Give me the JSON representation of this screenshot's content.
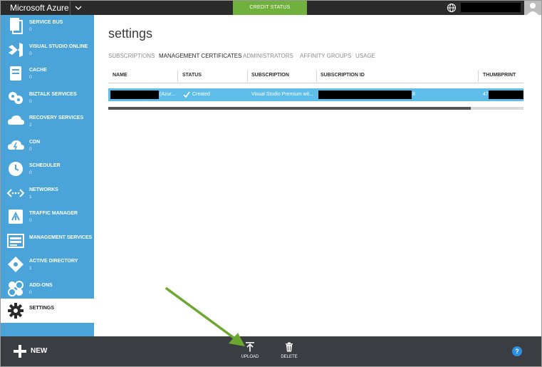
{
  "topbar": {
    "brand": "Microsoft Azure",
    "credit_status": "CREDIT STATUS"
  },
  "sidebar": {
    "items": [
      {
        "label": "SERVICE BUS",
        "count": "0",
        "icon": "service-bus-icon"
      },
      {
        "label": "VISUAL STUDIO ONLINE",
        "count": "0",
        "icon": "visual-studio-icon"
      },
      {
        "label": "CACHE",
        "count": "0",
        "icon": "cache-icon"
      },
      {
        "label": "BIZTALK SERVICES",
        "count": "0",
        "icon": "biztalk-icon"
      },
      {
        "label": "RECOVERY SERVICES",
        "count": "2",
        "icon": "recovery-icon"
      },
      {
        "label": "CDN",
        "count": "0",
        "icon": "cdn-icon"
      },
      {
        "label": "SCHEDULER",
        "count": "0",
        "icon": "scheduler-icon"
      },
      {
        "label": "NETWORKS",
        "count": "1",
        "icon": "networks-icon"
      },
      {
        "label": "TRAFFIC MANAGER",
        "count": "0",
        "icon": "traffic-manager-icon"
      },
      {
        "label": "MANAGEMENT SERVICES",
        "count": "",
        "icon": "management-services-icon"
      },
      {
        "label": "ACTIVE DIRECTORY",
        "count": "1",
        "icon": "active-directory-icon"
      },
      {
        "label": "ADD-ONS",
        "count": "0",
        "icon": "add-ons-icon"
      },
      {
        "label": "SETTINGS",
        "count": "",
        "icon": "gear-icon",
        "active": true
      }
    ]
  },
  "main": {
    "title": "settings",
    "tabs": [
      {
        "label": "SUBSCRIPTIONS",
        "active": false
      },
      {
        "label": "MANAGEMENT CERTIFICATES",
        "active": true
      },
      {
        "label": "ADMINISTRATORS",
        "active": false
      },
      {
        "label": "AFFINITY GROUPS",
        "active": false
      },
      {
        "label": "USAGE",
        "active": false
      }
    ],
    "table": {
      "columns": [
        "NAME",
        "STATUS",
        "SUBSCRIPTION",
        "SUBSCRIPTION ID",
        "THUMBPRINT"
      ],
      "rows": [
        {
          "name_suffix": "(Azur...",
          "status": "Created",
          "subscription": "Visual Studio Premium wit...",
          "subscription_id_suffix": "8",
          "thumbprint_prefix": "47"
        }
      ]
    }
  },
  "bottombar": {
    "new_label": "NEW",
    "upload_label": "UPLOAD",
    "delete_label": "DELETE",
    "help_glyph": "?"
  },
  "colors": {
    "topbar": "#2b2b2b",
    "credit_status": "#6fb13c",
    "sidebar": "#4aa4d9",
    "selected_row": "#5fbdea",
    "bottombar": "#3a3d42",
    "annotation_arrow": "#6aa82f"
  }
}
